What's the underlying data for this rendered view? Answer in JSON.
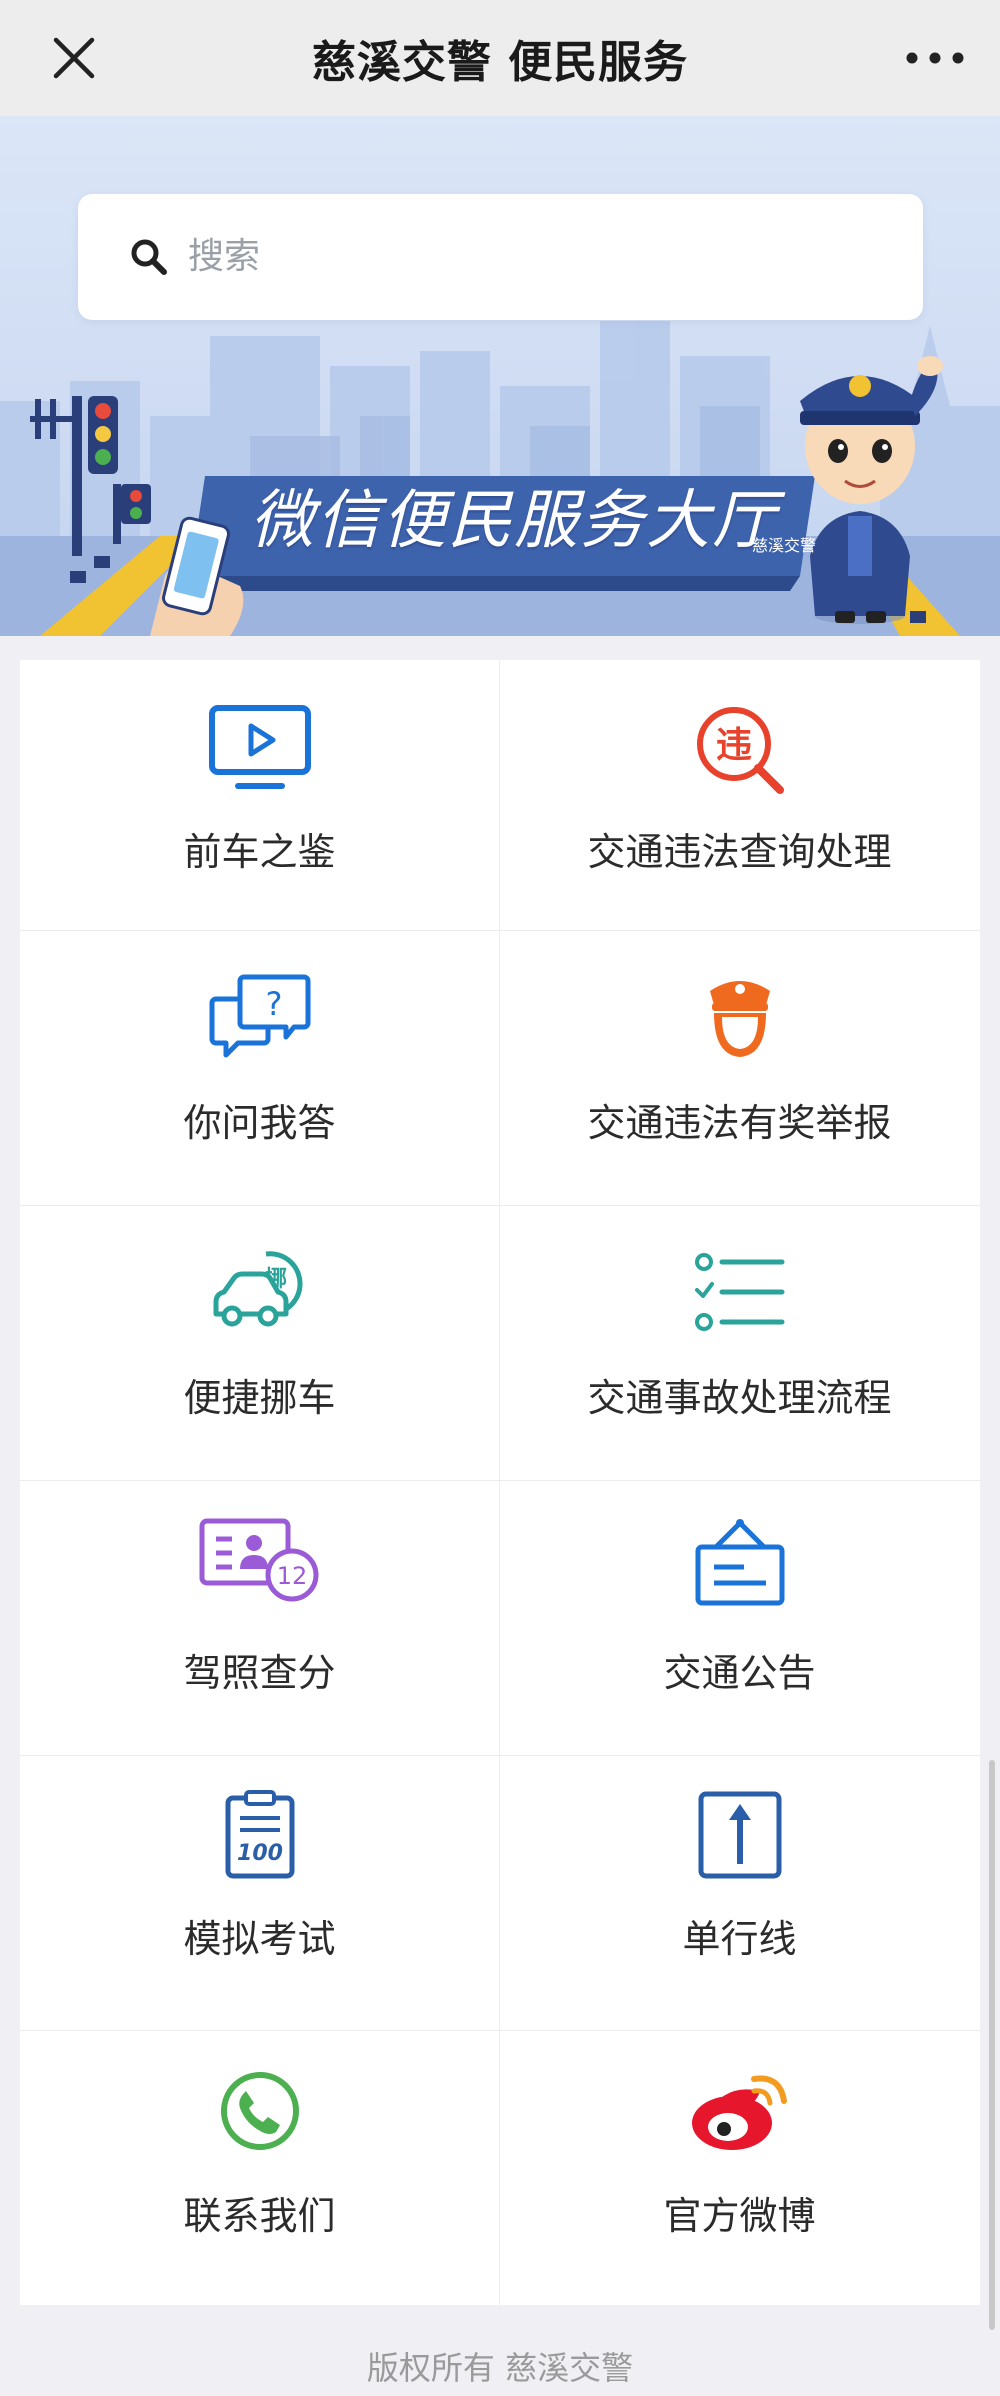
{
  "nav": {
    "title": "慈溪交警 便民服务"
  },
  "search": {
    "placeholder": "搜索"
  },
  "banner": {
    "title": "微信便民服务大厅",
    "subtitle": "慈溪交警"
  },
  "services": [
    {
      "label": "前车之鉴",
      "icon": "video-play-icon",
      "color": "#1a73d9"
    },
    {
      "label": "交通违法查询处理",
      "icon": "violation-search-icon",
      "color": "#e8412c"
    },
    {
      "label": "你问我答",
      "icon": "question-chat-icon",
      "color": "#1a73d9"
    },
    {
      "label": "交通违法有奖举报",
      "icon": "police-officer-icon",
      "color": "#ef6a1e"
    },
    {
      "label": "便捷挪车",
      "icon": "move-car-icon",
      "color": "#2aa39a"
    },
    {
      "label": "交通事故处理流程",
      "icon": "checklist-icon",
      "color": "#2aa39a"
    },
    {
      "label": "驾照查分",
      "icon": "license-score-icon",
      "color": "#9b5bd6"
    },
    {
      "label": "交通公告",
      "icon": "notice-board-icon",
      "color": "#1a73d9"
    },
    {
      "label": "模拟考试",
      "icon": "exam-clipboard-icon",
      "color": "#2a5ea8"
    },
    {
      "label": "单行线",
      "icon": "one-way-arrow-icon",
      "color": "#2a5ea8"
    },
    {
      "label": "联系我们",
      "icon": "phone-icon",
      "color": "#4caf50"
    },
    {
      "label": "官方微博",
      "icon": "weibo-icon",
      "color": "#e6162d"
    }
  ],
  "icon_text": {
    "violation": "违",
    "move": "挪",
    "score": "12",
    "exam": "100"
  },
  "footer": {
    "copyright": "版权所有 慈溪交警"
  }
}
